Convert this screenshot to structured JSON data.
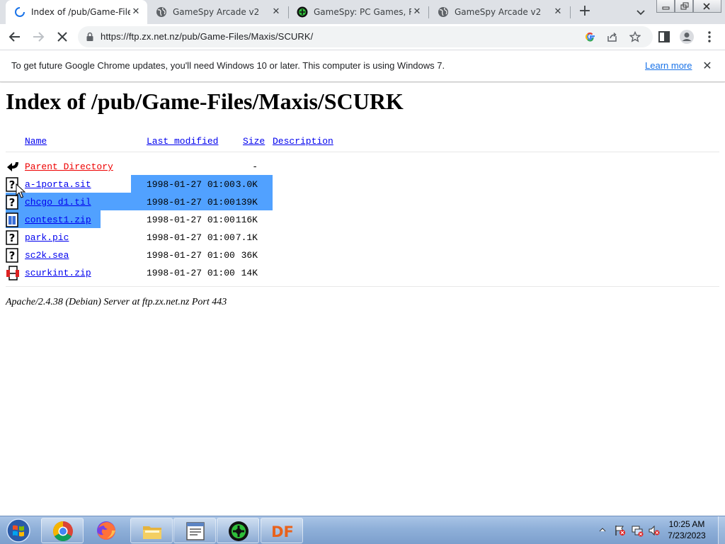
{
  "browser": {
    "tabs": [
      {
        "title": "Index of /pub/Game-Files/Maxis/SCURK",
        "favicon": "loading-spinner-icon",
        "active": true
      },
      {
        "title": "GameSpy Arcade v2",
        "favicon": "globe-icon",
        "active": false
      },
      {
        "title": "GameSpy: PC Games, Reviews",
        "favicon": "gamespy-logo-icon",
        "active": false
      },
      {
        "title": "GameSpy Arcade v2",
        "favicon": "globe-icon",
        "active": false
      }
    ],
    "url": "https://ftp.zx.net.nz/pub/Game-Files/Maxis/SCURK/",
    "infobar": {
      "message": "To get future Google Chrome updates, you'll need Windows 10 or later. This computer is using Windows 7.",
      "link": "Learn more"
    }
  },
  "listing": {
    "title": "Index of /pub/Game-Files/Maxis/SCURK",
    "headers": {
      "name": "Name",
      "modified": "Last modified",
      "size": "Size",
      "description": "Description"
    },
    "parent": {
      "name": "Parent Directory",
      "size": "-"
    },
    "rows": [
      {
        "name": "a-1porta.sit",
        "modified": "1998-01-27 01:00",
        "size": "3.0K",
        "icon": "unknown-file-icon"
      },
      {
        "name": "chcgo_d1.til",
        "modified": "1998-01-27 01:00",
        "size": "139K",
        "icon": "unknown-file-icon"
      },
      {
        "name": "contest1.zip",
        "modified": "1998-01-27 01:00",
        "size": "116K",
        "icon": "compressed-file-icon"
      },
      {
        "name": "park.pic",
        "modified": "1998-01-27 01:00",
        "size": "7.1K",
        "icon": "unknown-file-icon"
      },
      {
        "name": "sc2k.sea",
        "modified": "1998-01-27 01:00",
        "size": "36K",
        "icon": "unknown-file-icon"
      },
      {
        "name": "scurkint.zip",
        "modified": "1998-01-27 01:00",
        "size": "14K",
        "icon": "compressed-file-icon"
      }
    ],
    "footer": "Apache/2.4.38 (Debian) Server at ftp.zx.net.nz Port 443"
  },
  "taskbar": {
    "apps": [
      "chrome-icon",
      "firefox-icon",
      "file-explorer-icon",
      "notepad-window-icon",
      "gamespy-icon",
      "df-app-icon"
    ],
    "df_label": "DF",
    "time": "10:25 AM",
    "date": "7/23/2023"
  }
}
